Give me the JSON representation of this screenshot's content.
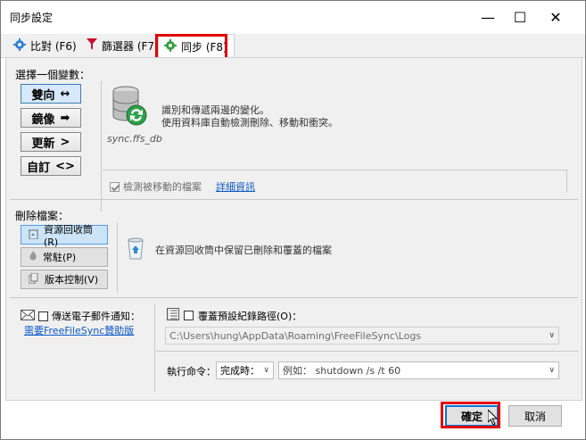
{
  "window": {
    "title": "同步設定",
    "minimize": "—",
    "maximize": "☐",
    "close": "✕"
  },
  "tabs": [
    {
      "label": "比對 (F6)"
    },
    {
      "label": "篩選器 (F7)"
    },
    {
      "label": "同步 (F8)"
    }
  ],
  "variant": {
    "heading": "選擇一個變數：",
    "buttons": [
      {
        "label": "雙向",
        "arrow": "↔"
      },
      {
        "label": "鏡像",
        "arrow": "➡"
      },
      {
        "label": "更新",
        "arrow": ">"
      },
      {
        "label": "自訂",
        "arrow": "<>"
      }
    ],
    "db_caption": "sync.ffs_db",
    "description_line1": "識別和傳遞兩邊的變化。",
    "description_line2": "使用資料庫自動檢測刪除、移動和衝突。",
    "detect_moved_label": "檢測被移動的檔案",
    "details_link": "詳細資訊"
  },
  "deletion": {
    "heading": "刪除檔案：",
    "buttons": [
      {
        "label": "資源回收筒(R)"
      },
      {
        "label": "常駐(P)"
      },
      {
        "label": "版本控制(V)"
      }
    ],
    "description": "在資源回收筒中保留已刪除和覆蓋的檔案"
  },
  "email": {
    "label": "傳送電子郵件通知：",
    "link": "需要FreeFileSync贊助版"
  },
  "log": {
    "override_label": "覆蓋預設紀錄路徑(O)：",
    "path": "C:\\Users\\hung\\AppData\\Roaming\\FreeFileSync\\Logs"
  },
  "command": {
    "label": "執行命令：",
    "when": "完成時：",
    "placeholder": "例如： shutdown /s /t 60"
  },
  "footer": {
    "ok": "確定",
    "cancel": "取消"
  }
}
